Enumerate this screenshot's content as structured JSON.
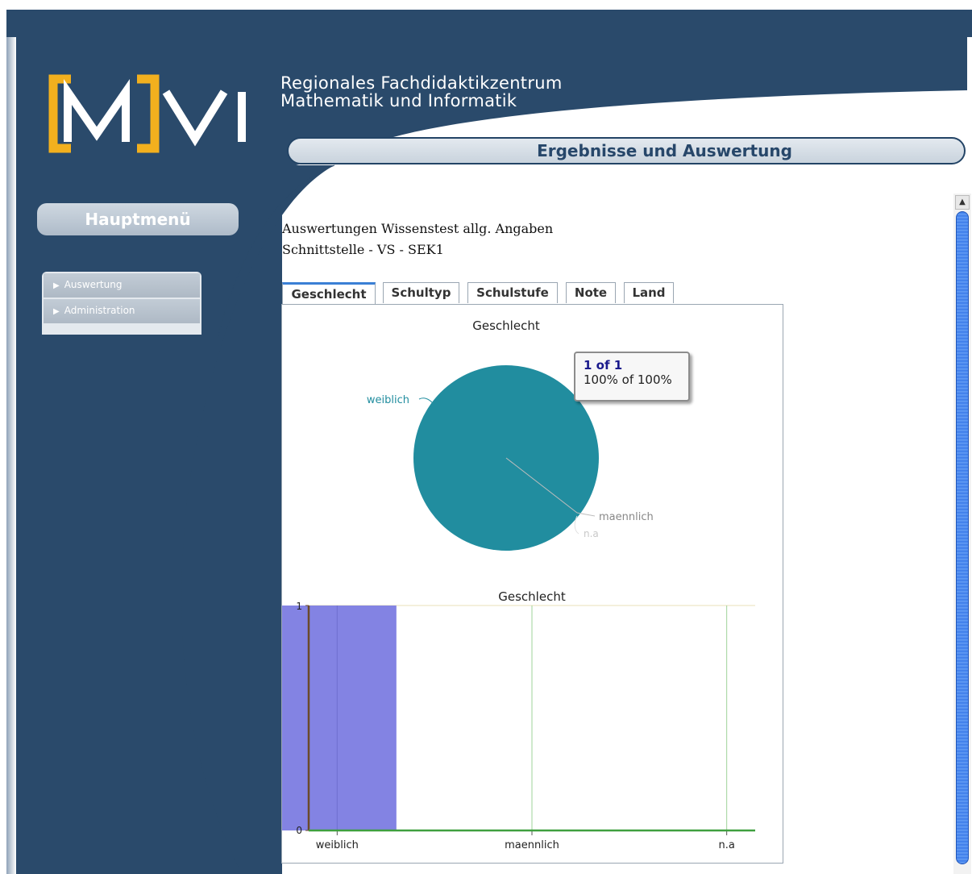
{
  "logo": {
    "text": "MVI",
    "bracket_color": "#f2b01e"
  },
  "site": {
    "line1": "Regionales Fachdidaktikzentrum",
    "line2": "Mathematik und Informatik"
  },
  "header": {
    "section_title": "Ergebnisse und Auswertung"
  },
  "sidebar": {
    "menu_button": "Hauptmenü",
    "items": [
      {
        "label": "Auswertung",
        "icon": "play-arrow-icon"
      },
      {
        "label": "Administration",
        "icon": "play-arrow-icon"
      }
    ]
  },
  "content": {
    "title_line1": "Auswertungen Wissenstest allg. Angaben",
    "title_line2": "Schnittstelle - VS - SEK1"
  },
  "tabs": [
    {
      "label": "Geschlecht",
      "active": true
    },
    {
      "label": "Schultyp",
      "active": false
    },
    {
      "label": "Schulstufe",
      "active": false
    },
    {
      "label": "Note",
      "active": false
    },
    {
      "label": "Land",
      "active": false
    }
  ],
  "tooltip": {
    "title": "1 of 1",
    "text": "100% of 100%"
  },
  "colors": {
    "navy": "#2a4a6b",
    "pie": "#218d9f",
    "bar": "#8383e3",
    "accent": "#3a7fd5"
  },
  "chart_data": [
    {
      "type": "pie",
      "title": "Geschlecht",
      "categories": [
        "weiblich",
        "maennlich",
        "n.a"
      ],
      "values": [
        1,
        0,
        0
      ]
    },
    {
      "type": "bar",
      "title": "Geschlecht",
      "categories": [
        "weiblich",
        "maennlich",
        "n.a"
      ],
      "values": [
        1,
        0,
        0
      ],
      "ylim": [
        0,
        1
      ],
      "yticks": [
        "0",
        "1"
      ]
    }
  ]
}
